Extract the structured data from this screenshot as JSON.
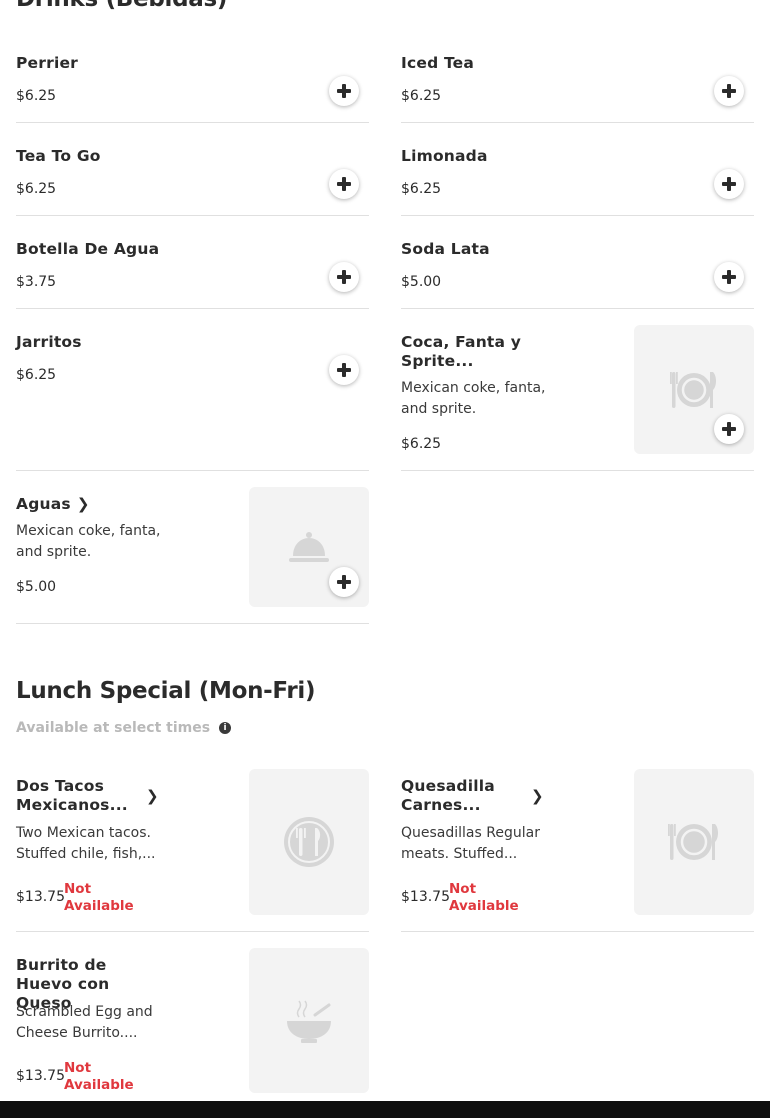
{
  "sections": {
    "drinks": {
      "title": "Drinks (Bebidas)"
    },
    "lunch": {
      "title": "Lunch Special (Mon-Fri)",
      "subtitle": "Available at select times"
    }
  },
  "drinks": [
    {
      "name": "Perrier",
      "price": "$6.25"
    },
    {
      "name": "Iced Tea",
      "price": "$6.25"
    },
    {
      "name": "Tea To Go",
      "price": "$6.25"
    },
    {
      "name": "Limonada",
      "price": "$6.25"
    },
    {
      "name": "Botella De Agua",
      "price": "$3.75"
    },
    {
      "name": "Soda Lata",
      "price": "$5.00"
    },
    {
      "name": "Jarritos",
      "price": "$6.25"
    },
    {
      "name": "Coca, Fanta y Sprite...",
      "description": "Mexican coke, fanta, and sprite.",
      "price": "$6.25",
      "image_icon": "plate-icon"
    },
    {
      "name": "Aguas",
      "description": "Mexican coke, fanta, and sprite.",
      "price": "$5.00",
      "image_icon": "cloche-icon"
    }
  ],
  "lunch": [
    {
      "name": "Dos Tacos Mexicanos...",
      "description": "Two Mexican tacos. Stuffed chile, fish,...",
      "price": "$13.75",
      "status": "Not Available",
      "image_icon": "utensils-icon"
    },
    {
      "name": "Quesadilla Carnes...",
      "description": "Quesadillas Regular meats. Stuffed...",
      "price": "$13.75",
      "status": "Not Available",
      "image_icon": "plate-icon"
    },
    {
      "name": "Burrito de Huevo con Queso",
      "description": "Scrambled Egg and Cheese Burrito....",
      "price": "$13.75",
      "status": "Not Available",
      "image_icon": "bowl-icon"
    }
  ],
  "colors": {
    "text": "#2b2b2b",
    "muted": "#b9b9b9",
    "unavailable": "#e0383e",
    "divider": "#e0e0e0",
    "thumb_bg": "#f3f3f3",
    "footer": "#0f0f0f"
  }
}
